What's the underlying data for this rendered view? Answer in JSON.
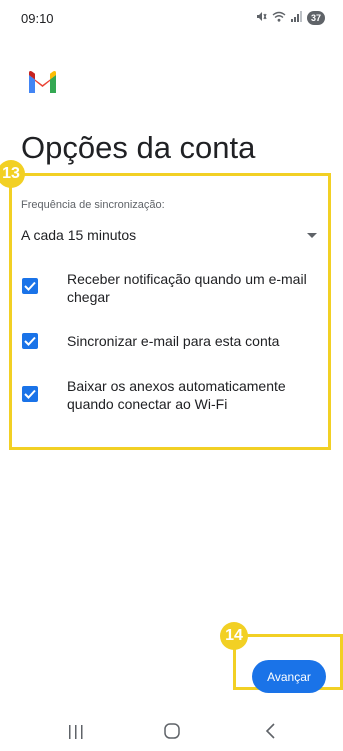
{
  "status_bar": {
    "time": "09:10",
    "battery": "37",
    "icons": [
      "mute-icon",
      "wifi-icon",
      "signal-icon",
      "battery-icon"
    ]
  },
  "app": {
    "logo": "gmail-logo"
  },
  "page": {
    "title": "Opções da conta"
  },
  "sync": {
    "label": "Frequência de sincronização:",
    "selected": "A cada 15 minutos"
  },
  "options": [
    {
      "label": "Receber notificação quando um e-mail chegar",
      "checked": true
    },
    {
      "label": "Sincronizar e-mail para esta conta",
      "checked": true
    },
    {
      "label": "Baixar os anexos automaticamente quando conectar ao Wi-Fi",
      "checked": true
    }
  ],
  "annotations": {
    "step_a": "13",
    "step_b": "14",
    "color": "#f2d024"
  },
  "actions": {
    "next_label": "Avançar"
  },
  "colors": {
    "accent": "#1a73e8",
    "highlight": "#f2d024"
  },
  "nav": {
    "icons": [
      "recents-icon",
      "home-icon",
      "back-icon"
    ]
  }
}
